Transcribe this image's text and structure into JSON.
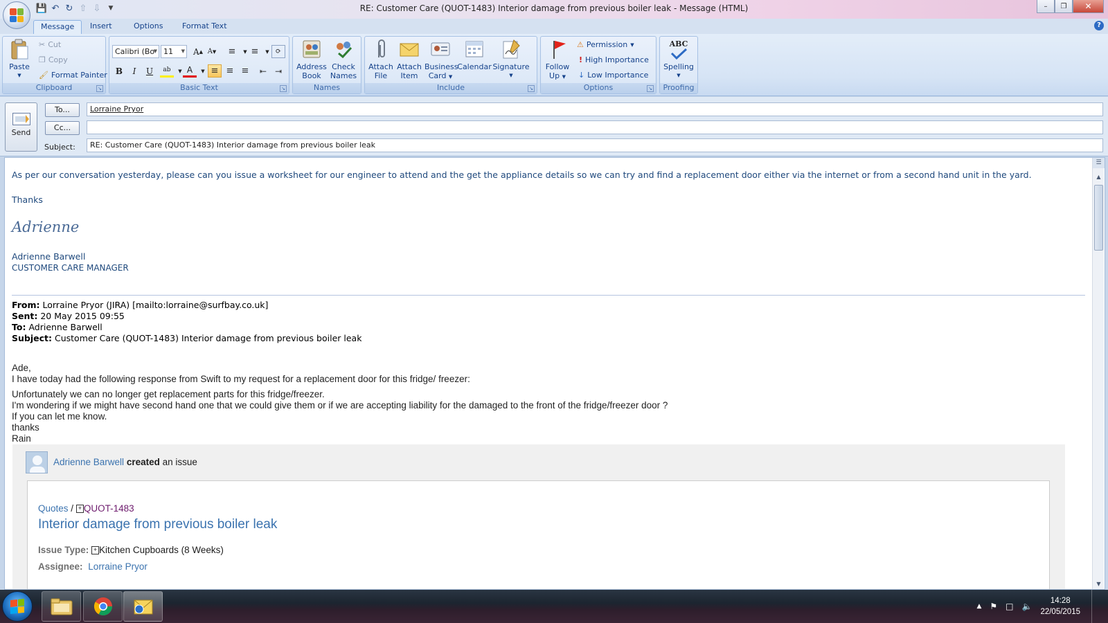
{
  "window": {
    "title": "RE: Customer Care (QUOT-1483) Interior damage from previous boiler leak - Message (HTML)",
    "controls": {
      "minimize": "–",
      "maximize": "❐",
      "close": "✕"
    }
  },
  "tabs": [
    "Message",
    "Insert",
    "Options",
    "Format Text"
  ],
  "active_tab": "Message",
  "ribbon": {
    "clipboard": {
      "label": "Clipboard",
      "paste": "Paste",
      "cut": "Cut",
      "copy": "Copy",
      "format_painter": "Format Painter"
    },
    "basic_text": {
      "label": "Basic Text",
      "font": "Calibri (Bo",
      "size": "11",
      "bold": "B",
      "italic": "I",
      "underline": "U"
    },
    "names": {
      "label": "Names",
      "address_book": [
        "Address",
        "Book"
      ],
      "check_names": [
        "Check",
        "Names"
      ]
    },
    "include": {
      "label": "Include",
      "attach_file": [
        "Attach",
        "File"
      ],
      "attach_item": [
        "Attach",
        "Item"
      ],
      "business_card": [
        "Business",
        "Card"
      ],
      "calendar": "Calendar",
      "signature": "Signature"
    },
    "options": {
      "label": "Options",
      "follow_up": [
        "Follow",
        "Up"
      ],
      "permission": "Permission",
      "high_importance": "High Importance",
      "low_importance": "Low Importance"
    },
    "proofing": {
      "label": "Proofing",
      "spelling": "Spelling",
      "abc": "ABC"
    }
  },
  "header": {
    "send": "Send",
    "to_button": "To...",
    "cc_button": "Cc...",
    "subject_label": "Subject:",
    "to_value": "Lorraine Pryor",
    "cc_value": "",
    "subject_value": "RE: Customer Care (QUOT-1483) Interior damage from previous boiler leak"
  },
  "body": {
    "reply_text": "As per our conversation yesterday, please can you issue a worksheet for our engineer to attend and the get the appliance details so we can try and find a replacement door either via the internet or from a second hand unit in the yard.",
    "thanks": "Thanks",
    "signature_script": "Adrienne",
    "sig_name": "Adrienne Barwell",
    "sig_title": "CUSTOMER CARE MANAGER",
    "quoted": {
      "from_label": "From:",
      "from": "Lorraine Pryor (JIRA) [mailto:lorraine@surfbay.co.uk]",
      "sent_label": "Sent:",
      "sent": "20 May 2015 09:55",
      "to_label": "To:",
      "to": "Adrienne Barwell",
      "subject_label": "Subject:",
      "subject": "Customer Care (QUOT-1483) Interior damage from previous boiler leak"
    },
    "message_lines": [
      "Ade,",
      "I have today had the following response from Swift to my request for a replacement door for this fridge/ freezer:",
      "Unfortunately we can no longer get replacement parts for this fridge/freezer.",
      "I'm wondering if we might have second hand one that we could give them or if we are accepting liability for the damaged to the front of the fridge/freezer door ?",
      "If you can let me know.",
      "thanks",
      "Rain"
    ],
    "jira": {
      "user": "Adrienne Barwell",
      "action": "created",
      "action_suffix": "an issue",
      "breadcrumb_project": "Quotes",
      "breadcrumb_sep": "/",
      "issue_key": "QUOT-1483",
      "issue_title": "Interior damage from previous boiler leak",
      "issue_type_label": "Issue Type:",
      "issue_type": "Kitchen Cupboards (8 Weeks)",
      "assignee_label": "Assignee:",
      "assignee": "Lorraine Pryor"
    }
  },
  "taskbar": {
    "time": "14:28",
    "date": "22/05/2015"
  },
  "colors": {
    "accent": "#15428b",
    "body_blue": "#1f497d",
    "jira_link": "#3b73af",
    "issue_key": "#6e1c6e"
  }
}
